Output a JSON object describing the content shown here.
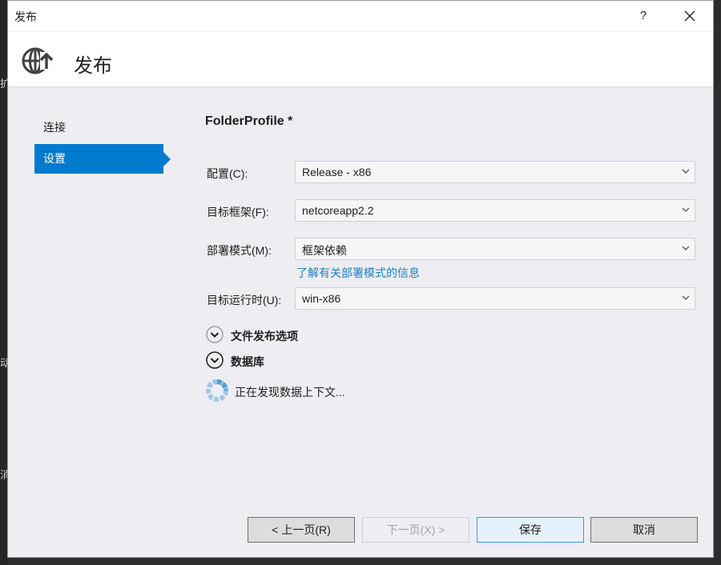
{
  "window": {
    "title": "发布",
    "help_label": "?",
    "close_label": "✕"
  },
  "header": {
    "title": "发布"
  },
  "nav": {
    "items": [
      {
        "label": "连接",
        "active": false
      },
      {
        "label": "设置",
        "active": true
      }
    ]
  },
  "settings": {
    "profile_name": "FolderProfile *",
    "configuration": {
      "label": "配置(C):",
      "value": "Release - x86"
    },
    "target_framework": {
      "label": "目标框架(F):",
      "value": "netcoreapp2.2"
    },
    "deployment_mode": {
      "label": "部署模式(M):",
      "value": "框架依赖"
    },
    "deployment_mode_link": "了解有关部署模式的信息",
    "target_runtime": {
      "label": "目标运行时(U):",
      "value": "win-x86"
    },
    "file_publish_options_label": "文件发布选项",
    "databases_label": "数据库",
    "discovering_text": "正在发现数据上下文..."
  },
  "buttons": {
    "previous": "< 上一页(R)",
    "next": "下一页(X) >",
    "save": "保存",
    "cancel": "取消"
  },
  "background": {
    "frag1": "扩",
    "frag2": "动",
    "frag3": "消"
  },
  "colors": {
    "accent": "#007acc",
    "link": "#1e7fc1",
    "dialog_bg": "#eeeef2"
  }
}
